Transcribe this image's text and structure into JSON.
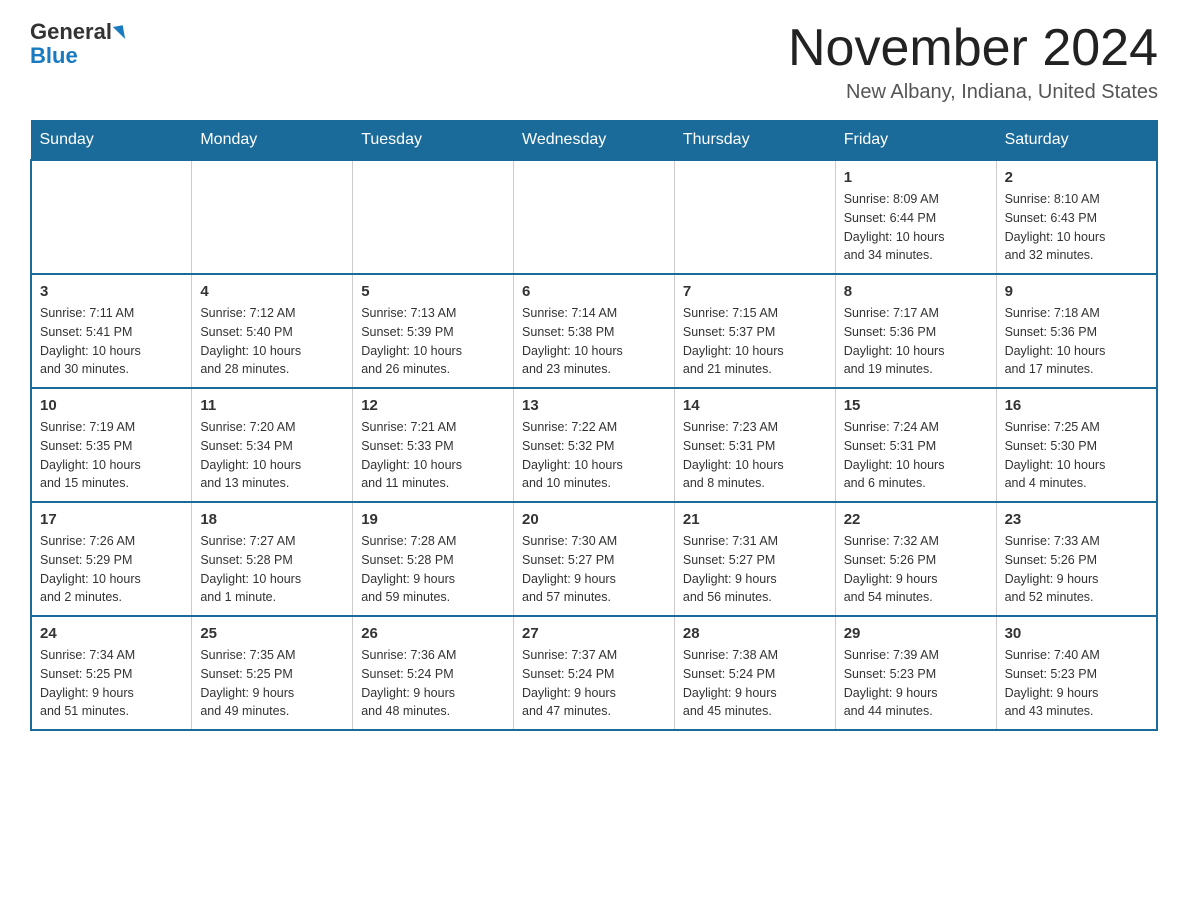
{
  "header": {
    "logo_general": "General",
    "logo_blue": "Blue",
    "month_title": "November 2024",
    "location": "New Albany, Indiana, United States"
  },
  "weekdays": [
    "Sunday",
    "Monday",
    "Tuesday",
    "Wednesday",
    "Thursday",
    "Friday",
    "Saturday"
  ],
  "weeks": [
    [
      {
        "day": "",
        "info": ""
      },
      {
        "day": "",
        "info": ""
      },
      {
        "day": "",
        "info": ""
      },
      {
        "day": "",
        "info": ""
      },
      {
        "day": "",
        "info": ""
      },
      {
        "day": "1",
        "info": "Sunrise: 8:09 AM\nSunset: 6:44 PM\nDaylight: 10 hours\nand 34 minutes."
      },
      {
        "day": "2",
        "info": "Sunrise: 8:10 AM\nSunset: 6:43 PM\nDaylight: 10 hours\nand 32 minutes."
      }
    ],
    [
      {
        "day": "3",
        "info": "Sunrise: 7:11 AM\nSunset: 5:41 PM\nDaylight: 10 hours\nand 30 minutes."
      },
      {
        "day": "4",
        "info": "Sunrise: 7:12 AM\nSunset: 5:40 PM\nDaylight: 10 hours\nand 28 minutes."
      },
      {
        "day": "5",
        "info": "Sunrise: 7:13 AM\nSunset: 5:39 PM\nDaylight: 10 hours\nand 26 minutes."
      },
      {
        "day": "6",
        "info": "Sunrise: 7:14 AM\nSunset: 5:38 PM\nDaylight: 10 hours\nand 23 minutes."
      },
      {
        "day": "7",
        "info": "Sunrise: 7:15 AM\nSunset: 5:37 PM\nDaylight: 10 hours\nand 21 minutes."
      },
      {
        "day": "8",
        "info": "Sunrise: 7:17 AM\nSunset: 5:36 PM\nDaylight: 10 hours\nand 19 minutes."
      },
      {
        "day": "9",
        "info": "Sunrise: 7:18 AM\nSunset: 5:36 PM\nDaylight: 10 hours\nand 17 minutes."
      }
    ],
    [
      {
        "day": "10",
        "info": "Sunrise: 7:19 AM\nSunset: 5:35 PM\nDaylight: 10 hours\nand 15 minutes."
      },
      {
        "day": "11",
        "info": "Sunrise: 7:20 AM\nSunset: 5:34 PM\nDaylight: 10 hours\nand 13 minutes."
      },
      {
        "day": "12",
        "info": "Sunrise: 7:21 AM\nSunset: 5:33 PM\nDaylight: 10 hours\nand 11 minutes."
      },
      {
        "day": "13",
        "info": "Sunrise: 7:22 AM\nSunset: 5:32 PM\nDaylight: 10 hours\nand 10 minutes."
      },
      {
        "day": "14",
        "info": "Sunrise: 7:23 AM\nSunset: 5:31 PM\nDaylight: 10 hours\nand 8 minutes."
      },
      {
        "day": "15",
        "info": "Sunrise: 7:24 AM\nSunset: 5:31 PM\nDaylight: 10 hours\nand 6 minutes."
      },
      {
        "day": "16",
        "info": "Sunrise: 7:25 AM\nSunset: 5:30 PM\nDaylight: 10 hours\nand 4 minutes."
      }
    ],
    [
      {
        "day": "17",
        "info": "Sunrise: 7:26 AM\nSunset: 5:29 PM\nDaylight: 10 hours\nand 2 minutes."
      },
      {
        "day": "18",
        "info": "Sunrise: 7:27 AM\nSunset: 5:28 PM\nDaylight: 10 hours\nand 1 minute."
      },
      {
        "day": "19",
        "info": "Sunrise: 7:28 AM\nSunset: 5:28 PM\nDaylight: 9 hours\nand 59 minutes."
      },
      {
        "day": "20",
        "info": "Sunrise: 7:30 AM\nSunset: 5:27 PM\nDaylight: 9 hours\nand 57 minutes."
      },
      {
        "day": "21",
        "info": "Sunrise: 7:31 AM\nSunset: 5:27 PM\nDaylight: 9 hours\nand 56 minutes."
      },
      {
        "day": "22",
        "info": "Sunrise: 7:32 AM\nSunset: 5:26 PM\nDaylight: 9 hours\nand 54 minutes."
      },
      {
        "day": "23",
        "info": "Sunrise: 7:33 AM\nSunset: 5:26 PM\nDaylight: 9 hours\nand 52 minutes."
      }
    ],
    [
      {
        "day": "24",
        "info": "Sunrise: 7:34 AM\nSunset: 5:25 PM\nDaylight: 9 hours\nand 51 minutes."
      },
      {
        "day": "25",
        "info": "Sunrise: 7:35 AM\nSunset: 5:25 PM\nDaylight: 9 hours\nand 49 minutes."
      },
      {
        "day": "26",
        "info": "Sunrise: 7:36 AM\nSunset: 5:24 PM\nDaylight: 9 hours\nand 48 minutes."
      },
      {
        "day": "27",
        "info": "Sunrise: 7:37 AM\nSunset: 5:24 PM\nDaylight: 9 hours\nand 47 minutes."
      },
      {
        "day": "28",
        "info": "Sunrise: 7:38 AM\nSunset: 5:24 PM\nDaylight: 9 hours\nand 45 minutes."
      },
      {
        "day": "29",
        "info": "Sunrise: 7:39 AM\nSunset: 5:23 PM\nDaylight: 9 hours\nand 44 minutes."
      },
      {
        "day": "30",
        "info": "Sunrise: 7:40 AM\nSunset: 5:23 PM\nDaylight: 9 hours\nand 43 minutes."
      }
    ]
  ]
}
